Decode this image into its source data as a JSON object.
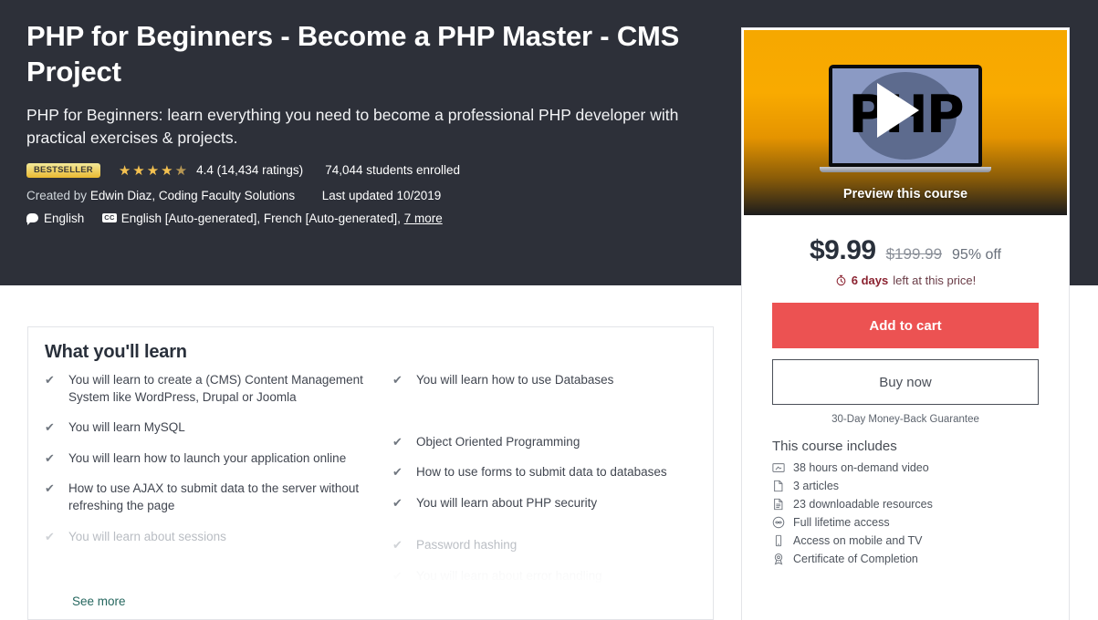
{
  "hero": {
    "title": "PHP for Beginners - Become a PHP Master - CMS Project",
    "subtitle": "PHP for Beginners: learn everything you need to become a professional PHP developer with practical exercises & projects.",
    "bestseller_badge": "BESTSELLER",
    "rating_value": "4.4",
    "rating_count": "(14,434 ratings)",
    "students_enrolled": "74,044 students enrolled",
    "created_by_label": "Created by",
    "authors": "Edwin Diaz, Coding Faculty Solutions",
    "last_updated": "Last updated 10/2019",
    "audio_language": "English",
    "captions": "English [Auto-generated], French [Auto-generated],",
    "captions_more": "7 more",
    "stars_full": 4,
    "stars_half": 1,
    "background_color": "#2d3039",
    "badge_color": "#eab932",
    "star_color": "#f4c150"
  },
  "preview": {
    "label": "Preview this course",
    "logo_text": "PHP",
    "accent_color": "#f6a800"
  },
  "pricing": {
    "current_price": "$9.99",
    "original_price": "$199.99",
    "discount": "95% off",
    "deadline_strong": "6 days",
    "deadline_rest": "left at this price!",
    "add_to_cart_label": "Add to cart",
    "buy_now_label": "Buy now",
    "guarantee": "30-Day Money-Back Guarantee",
    "cta_color": "#ec5252"
  },
  "includes": {
    "title": "This course includes",
    "items": [
      {
        "icon": "video-icon",
        "label": "38 hours on-demand video"
      },
      {
        "icon": "article-icon",
        "label": "3 articles"
      },
      {
        "icon": "download-icon",
        "label": "23 downloadable resources"
      },
      {
        "icon": "infinity-icon",
        "label": "Full lifetime access"
      },
      {
        "icon": "mobile-icon",
        "label": "Access on mobile and TV"
      },
      {
        "icon": "certificate-icon",
        "label": "Certificate of Completion"
      }
    ]
  },
  "learn": {
    "title": "What you'll learn",
    "see_more_label": "See more",
    "left_items": [
      {
        "text": "You will learn to create a (CMS) Content Management System like WordPress, Drupal or Joomla",
        "state": "normal"
      },
      {
        "text": "You will learn MySQL",
        "state": "normal"
      },
      {
        "text": "You will learn how to launch your application online",
        "state": "normal"
      },
      {
        "text": "How to use AJAX to submit data to the server without refreshing the page",
        "state": "normal"
      },
      {
        "text": "You will learn about sessions",
        "state": "faded"
      }
    ],
    "right_items": [
      {
        "text": "You will learn how to use Databases",
        "state": "normal"
      },
      {
        "text": "Object Oriented Programming",
        "state": "normal"
      },
      {
        "text": "How to use forms to submit data to databases",
        "state": "normal"
      },
      {
        "text": "You will learn about PHP security",
        "state": "normal"
      },
      {
        "text": "Password hashing",
        "state": "faded"
      },
      {
        "text": "You will learn about error handling",
        "state": "faded2"
      }
    ],
    "check_glyph": "✔"
  }
}
